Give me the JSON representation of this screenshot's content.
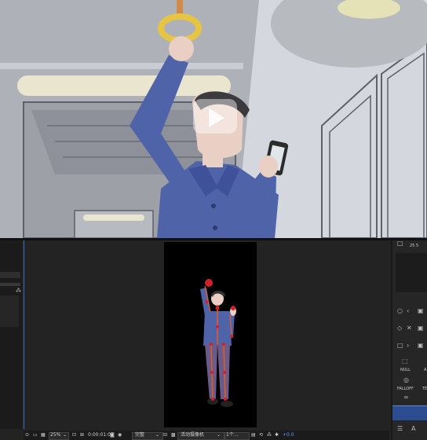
{
  "scene": {
    "description_icon": "play-icon"
  },
  "editor": {
    "right_panel": {
      "frame_rate": "25 5",
      "null_label": "NULL",
      "falloff_label": "FALLOFF",
      "te_label": "TE",
      "a_label": "A"
    },
    "status_bar": {
      "zoom": "25%",
      "timecode": "0:00:01:07",
      "resolution": "完整",
      "camera": "活动摄像机",
      "views": "1个...",
      "exposure": "+0.0"
    },
    "colors": {
      "accent": "#3a6cc9",
      "timeline_blue": "#2b4c8f"
    }
  }
}
